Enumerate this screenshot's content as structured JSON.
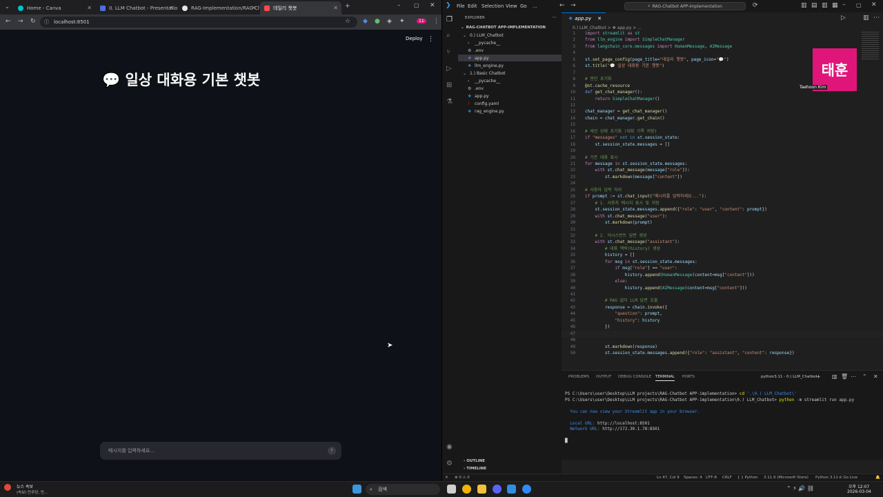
{
  "chrome": {
    "tabs": [
      {
        "label": "Home - Canva",
        "color": "#00c4cc"
      },
      {
        "label": "0. LLM Chatbot - Presentation",
        "color": "#4f6fd8"
      },
      {
        "label": "RAG-Implementation/RAG Ch",
        "color": "#e6e6e6"
      },
      {
        "label": "데일리 챗봇",
        "color": "#ff4b4b"
      }
    ],
    "url": "localhost:8501",
    "profile_badge": "11"
  },
  "streamlit": {
    "title": "💬 일상 대화용 기본 챗봇",
    "deploy": "Deploy",
    "chat_placeholder": "메시지를 입력하세요..."
  },
  "vscode": {
    "menu": [
      "File",
      "Edit",
      "Selection",
      "View",
      "Go",
      "..."
    ],
    "search": "RAG-Chatbot APP-implementation",
    "explorer_header": "EXPLORER",
    "root": "RAG-CHATBOT APP-IMPLEMENTATION",
    "tree": [
      {
        "label": "0.) LLM_Chatbot",
        "indent": 1,
        "icon": "v"
      },
      {
        "label": "__pycache__",
        "indent": 2,
        "icon": ">"
      },
      {
        "label": ".env",
        "indent": 2,
        "icon": "⚙"
      },
      {
        "label": "app.py",
        "indent": 2,
        "icon": "py",
        "selected": true
      },
      {
        "label": "llm_engine.py",
        "indent": 2,
        "icon": "py"
      },
      {
        "label": "1.) Basic Chatbot",
        "indent": 1,
        "icon": "v"
      },
      {
        "label": "__pycache__",
        "indent": 2,
        "icon": ">"
      },
      {
        "label": ".env",
        "indent": 2,
        "icon": "⚙"
      },
      {
        "label": "app.py",
        "indent": 2,
        "icon": "py"
      },
      {
        "label": "config.yaml",
        "indent": 2,
        "icon": "!"
      },
      {
        "label": "rag_engine.py",
        "indent": 2,
        "icon": "py"
      }
    ],
    "editor_tab": "app.py",
    "breadcrumb": "0.) LLM_Chatbot > ❖ app.py > ...",
    "code": [
      "<span class='k'>import</span> <span class='t'>streamlit</span> <span class='k'>as</span> <span class='t'>st</span>",
      "<span class='k'>from</span> <span class='t'>llm_engine</span> <span class='k'>import</span> <span class='t'>SimpleChatManager</span>",
      "<span class='k'>from</span> <span class='t'>langchain_core.messages</span> <span class='k'>import</span> <span class='t'>HumanMessage</span>, <span class='t'>AIMessage</span>",
      "",
      "<span class='v'>st</span>.<span class='f'>set_page_config</span>(<span class='v'>page_title</span>=<span class='s'>\"데일리 챗봇\"</span>, <span class='v'>page_icon</span>=<span class='s'>\"💬\"</span>)",
      "<span class='v'>st</span>.<span class='f'>title</span>(<span class='s'>\"💬 일상 대화용 기본 챗봇\"</span>)",
      "",
      "<span class='c'># 엔진 초기화</span>",
      "<span class='f'>@st.cache_resource</span>",
      "<span class='n'>def</span> <span class='f'>get_chat_manager</span>():",
      "    <span class='k'>return</span> <span class='t'>SimpleChatManager</span>()",
      "",
      "<span class='v'>chat_manager</span> = <span class='f'>get_chat_manager</span>()",
      "<span class='v'>chain</span> = <span class='v'>chat_manager</span>.<span class='f'>get_chain</span>()",
      "",
      "<span class='c'># 세션 상태 초기화 (대화 기록 저장)</span>",
      "<span class='k'>if</span> <span class='s'>\"messages\"</span> <span class='n'>not in</span> <span class='v'>st</span>.<span class='v'>session_state</span>:",
      "    <span class='v'>st</span>.<span class='v'>session_state</span>.<span class='v'>messages</span> = []",
      "",
      "<span class='c'># 기존 대화 표시</span>",
      "<span class='k'>for</span> <span class='v'>message</span> <span class='k'>in</span> <span class='v'>st</span>.<span class='v'>session_state</span>.<span class='v'>messages</span>:",
      "    <span class='k'>with</span> <span class='v'>st</span>.<span class='f'>chat_message</span>(<span class='v'>message</span>[<span class='s'>\"role\"</span>]):",
      "        <span class='v'>st</span>.<span class='f'>markdown</span>(<span class='v'>message</span>[<span class='s'>\"content\"</span>])",
      "",
      "<span class='c'># 사용자 입력 처리</span>",
      "<span class='k'>if</span> <span class='v'>prompt</span> := <span class='v'>st</span>.<span class='f'>chat_input</span>(<span class='s'>\"메시지를 입력하세요...\"</span>):",
      "    <span class='c'># 1. 사용자 메시지 표시 및 저장</span>",
      "    <span class='v'>st</span>.<span class='v'>session_state</span>.<span class='v'>messages</span>.<span class='f'>append</span>({<span class='s'>\"role\"</span>: <span class='s'>\"user\"</span>, <span class='s'>\"content\"</span>: <span class='v'>prompt</span>})",
      "    <span class='k'>with</span> <span class='v'>st</span>.<span class='f'>chat_message</span>(<span class='s'>\"user\"</span>):",
      "        <span class='v'>st</span>.<span class='f'>markdown</span>(<span class='v'>prompt</span>)",
      "",
      "    <span class='c'># 2. 어시스턴트 답변 생성</span>",
      "    <span class='k'>with</span> <span class='v'>st</span>.<span class='f'>chat_message</span>(<span class='s'>\"assistant\"</span>):",
      "        <span class='c'># 대화 맥락(history) 생성</span>",
      "        <span class='v'>history</span> = []",
      "        <span class='k'>for</span> <span class='v'>msg</span> <span class='k'>in</span> <span class='v'>st</span>.<span class='v'>session_state</span>.<span class='v'>messages</span>:",
      "            <span class='k'>if</span> <span class='v'>msg</span>[<span class='s'>\"role\"</span>] == <span class='s'>\"user\"</span>:",
      "                <span class='v'>history</span>.<span class='f'>append</span>(<span class='t'>HumanMessage</span>(<span class='v'>content</span>=<span class='v'>msg</span>[<span class='s'>\"content\"</span>]))",
      "            <span class='k'>else</span>:",
      "                <span class='v'>history</span>.<span class='f'>append</span>(<span class='t'>AIMessage</span>(<span class='v'>content</span>=<span class='v'>msg</span>[<span class='s'>\"content\"</span>]))",
      "",
      "        <span class='c'># RAG 없이 LLM 답변 호출</span>",
      "        <span class='v'>response</span> = <span class='v'>chain</span>.<span class='f'>invoke</span>({",
      "            <span class='s'>\"question\"</span>: <span class='v'>prompt</span>,",
      "            <span class='s'>\"history\"</span>: <span class='v'>history</span>",
      "        })",
      "",
      "",
      "        <span class='v'>st</span>.<span class='f'>markdown</span>(<span class='v'>response</span>)",
      "        <span class='v'>st</span>.<span class='v'>session_state</span>.<span class='v'>messages</span>.<span class='f'>append</span>({<span class='s'>\"role\"</span>: <span class='s'>\"assistant\"</span>, <span class='s'>\"content\"</span>: <span class='v'>response</span>})"
    ],
    "current_line": 47,
    "avatar_text": "태훈",
    "avatar_name": "Taehoon Kim",
    "panel_tabs": [
      "PROBLEMS",
      "OUTPUT",
      "DEBUG CONSOLE",
      "TERMINAL",
      "PORTS"
    ],
    "terminal_name": "python3.11 - 0.) LLM_Chatbot",
    "terminal": [
      "PS C:\\Users\\user\\Desktop\\LLM projects\\RAG-Chatbot APP-implementation> <span class='yellow'>cd</span> <span class='blue'>'.\\0.) LLM_Chatbot\\'</span>",
      "PS C:\\Users\\user\\Desktop\\LLM projects\\RAG-Chatbot APP-implementation\\0.) LLM_Chatbot> <span class='yellow'>python</span> -m streamlit run app.py",
      "",
      "  <span class='blue'>You can now view your Streamlit app in your browser.</span>",
      "",
      "  <span class='blue'>Local URL: </span>http://localhost:8501",
      "  <span class='blue'>Network URL: </span>http://172.30.1.78:8501",
      "",
      "█"
    ],
    "outline": "OUTLINE",
    "timeline": "TIMELINE",
    "status": {
      "errors": "⊗ 0 ⚠ 0",
      "position": "Ln 47, Col 9",
      "spaces": "Spaces: 4",
      "encoding": "UTF-8",
      "eol": "CRLF",
      "language": "{ } Python",
      "interpreter": "3.11.9 (Microsoft Store)",
      "python": "Python 3.11",
      "golive": "⊘ Go Live"
    }
  },
  "taskbar": {
    "news_title": "뉴스 속보",
    "news_sub": "(속보) 민주당, 민...",
    "search": "검색",
    "time": "오후 12:07",
    "date": "2026-03-04"
  }
}
